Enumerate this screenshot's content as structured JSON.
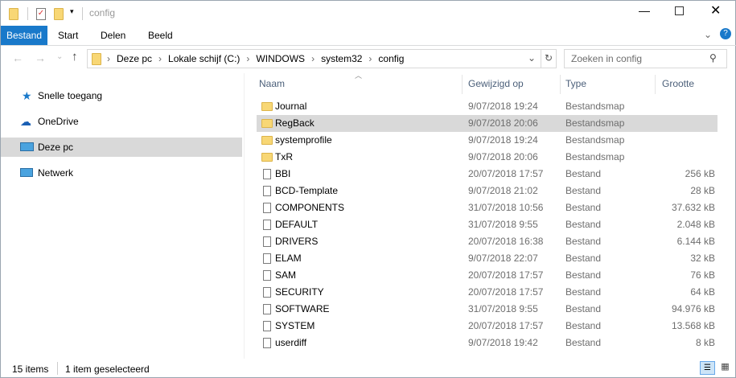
{
  "window": {
    "title": "config"
  },
  "ribbon": {
    "tabs": [
      "Bestand",
      "Start",
      "Delen",
      "Beeld"
    ]
  },
  "address": {
    "crumbs": [
      "Deze pc",
      "Lokale schijf (C:)",
      "WINDOWS",
      "system32",
      "config"
    ],
    "search_placeholder": "Zoeken in config"
  },
  "sidebar": {
    "items": [
      "Snelle toegang",
      "OneDrive",
      "Deze pc",
      "Netwerk"
    ]
  },
  "columns": [
    "Naam",
    "Gewijzigd op",
    "Type",
    "Grootte"
  ],
  "files": [
    {
      "name": "Journal",
      "date": "9/07/2018 19:24",
      "type": "Bestandsmap",
      "size": "",
      "folder": true
    },
    {
      "name": "RegBack",
      "date": "9/07/2018 20:06",
      "type": "Bestandsmap",
      "size": "",
      "folder": true
    },
    {
      "name": "systemprofile",
      "date": "9/07/2018 19:24",
      "type": "Bestandsmap",
      "size": "",
      "folder": true
    },
    {
      "name": "TxR",
      "date": "9/07/2018 20:06",
      "type": "Bestandsmap",
      "size": "",
      "folder": true
    },
    {
      "name": "BBI",
      "date": "20/07/2018 17:57",
      "type": "Bestand",
      "size": "256 kB"
    },
    {
      "name": "BCD-Template",
      "date": "9/07/2018 21:02",
      "type": "Bestand",
      "size": "28 kB"
    },
    {
      "name": "COMPONENTS",
      "date": "31/07/2018 10:56",
      "type": "Bestand",
      "size": "37.632 kB"
    },
    {
      "name": "DEFAULT",
      "date": "31/07/2018 9:55",
      "type": "Bestand",
      "size": "2.048 kB"
    },
    {
      "name": "DRIVERS",
      "date": "20/07/2018 16:38",
      "type": "Bestand",
      "size": "6.144 kB"
    },
    {
      "name": "ELAM",
      "date": "9/07/2018 22:07",
      "type": "Bestand",
      "size": "32 kB"
    },
    {
      "name": "SAM",
      "date": "20/07/2018 17:57",
      "type": "Bestand",
      "size": "76 kB"
    },
    {
      "name": "SECURITY",
      "date": "20/07/2018 17:57",
      "type": "Bestand",
      "size": "64 kB"
    },
    {
      "name": "SOFTWARE",
      "date": "31/07/2018 9:55",
      "type": "Bestand",
      "size": "94.976 kB"
    },
    {
      "name": "SYSTEM",
      "date": "20/07/2018 17:57",
      "type": "Bestand",
      "size": "13.568 kB"
    },
    {
      "name": "userdiff",
      "date": "9/07/2018 19:42",
      "type": "Bestand",
      "size": "8 kB"
    }
  ],
  "selected_index": 1,
  "status": {
    "count": "15 items",
    "selection": "1 item geselecteerd"
  },
  "colors": {
    "accent": "#1979ca",
    "selection": "#d9d9d9"
  }
}
